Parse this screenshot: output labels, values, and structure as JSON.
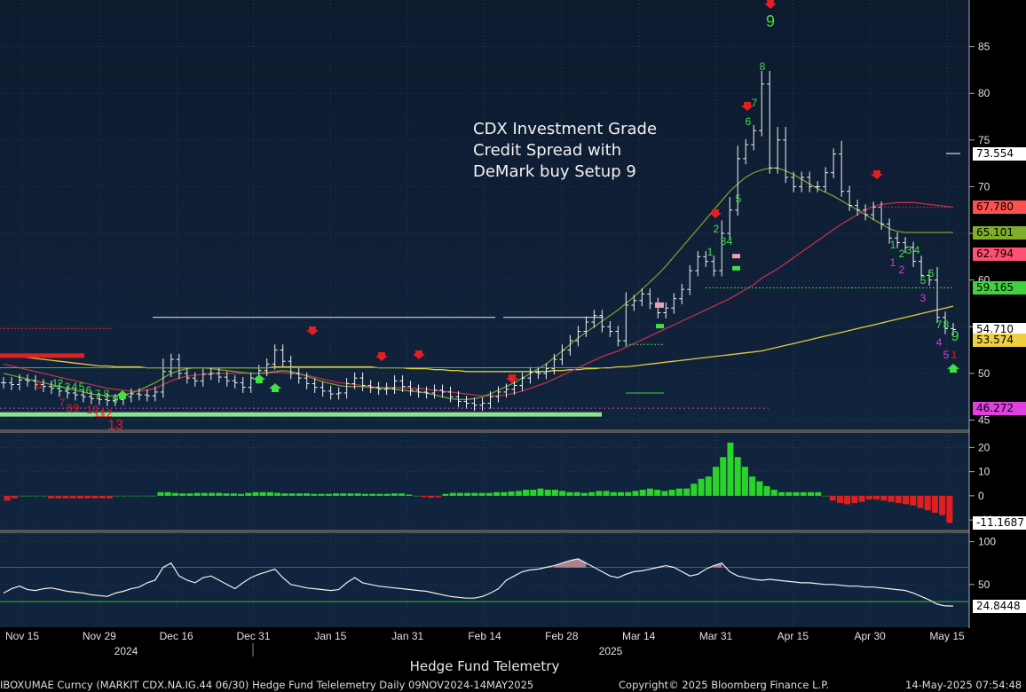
{
  "annotation": {
    "line1": "CDX Investment Grade",
    "line2": "Credit Spread with",
    "line3": "DeMark buy Setup 9"
  },
  "footer": {
    "title": "Hedge Fund Telemetry",
    "security": "IBOXUMAE Curncy (MARKIT CDX.NA.IG.44 06/30) Hedge Fund Telelemetry  Daily 09NOV2024-14MAY2025",
    "copyright": "Copyright© 2025 Bloomberg Finance L.P.",
    "timestamp": "14-May-2025 07:54:48"
  },
  "chart_data": [
    {
      "type": "line",
      "panel": "price",
      "ylim": [
        44,
        90
      ],
      "y_ticks": [
        45,
        50,
        55,
        60,
        65,
        70,
        75,
        80,
        85
      ],
      "x_tick_labels": [
        "Nov 15",
        "Nov 29",
        "Dec 16",
        "Dec 31",
        "Jan 15",
        "Jan 31",
        "Feb 14",
        "Feb 28",
        "Mar 14",
        "Mar 31",
        "Apr 15",
        "Apr 30",
        "May 15"
      ],
      "year_labels": [
        "2024",
        "2025"
      ],
      "price_closes": [
        49.0,
        48.8,
        49.3,
        49.2,
        48.8,
        48.6,
        48.4,
        48.1,
        47.9,
        47.7,
        47.5,
        47.3,
        47.2,
        47.1,
        47.2,
        47.5,
        47.8,
        47.7,
        47.6,
        48.0,
        50.2,
        51.5,
        50.0,
        49.5,
        49.2,
        49.9,
        50.0,
        49.6,
        49.2,
        49.0,
        48.5,
        49.5,
        50.3,
        51.0,
        52.5,
        51.3,
        50.0,
        49.5,
        48.9,
        48.5,
        48.1,
        47.8,
        47.9,
        48.9,
        49.5,
        48.7,
        48.5,
        48.3,
        48.4,
        49.2,
        48.6,
        48.2,
        48.0,
        47.9,
        48.2,
        48.0,
        47.5,
        47.0,
        46.8,
        46.6,
        46.8,
        47.5,
        48.0,
        48.3,
        48.7,
        49.5,
        50.1,
        50.0,
        50.5,
        51.5,
        52.5,
        53.5,
        54.5,
        55.5,
        56.2,
        55.0,
        54.5,
        53.5,
        57.3,
        57.8,
        58.5,
        57.5,
        56.5,
        57.0,
        58.0,
        59.0,
        61.0,
        62.5,
        62.0,
        61.0,
        65.0,
        67.5,
        73.0,
        74.5,
        76.0,
        81.0,
        72.0,
        75.0,
        71.0,
        70.0,
        71.0,
        70.0,
        70.0,
        71.5,
        73.5,
        69.5,
        68.0,
        67.5,
        67.0,
        67.8,
        66.0,
        64.5,
        64.0,
        63.5,
        62.0,
        60.5,
        60.0,
        56.0,
        54.8,
        54.7
      ],
      "series": [
        {
          "name": "",
          "color": "#e8c840",
          "values": [
            52.0,
            51.9,
            51.8,
            51.7,
            51.6,
            51.5,
            51.4,
            51.3,
            51.2,
            51.1,
            51.0,
            50.9,
            50.8,
            50.8,
            50.7,
            50.7,
            50.7,
            50.7,
            50.6,
            50.6,
            50.6,
            50.6,
            50.6,
            50.6,
            50.6,
            50.6,
            50.6,
            50.6,
            50.6,
            50.6,
            50.6,
            50.6,
            50.6,
            50.6,
            50.7,
            50.7,
            50.7,
            50.7,
            50.7,
            50.7,
            50.7,
            50.7,
            50.7,
            50.7,
            50.7,
            50.7,
            50.7,
            50.6,
            50.6,
            50.6,
            50.6,
            50.5,
            50.5,
            50.5,
            50.4,
            50.4,
            50.3,
            50.3,
            50.2,
            50.2,
            50.2,
            50.2,
            50.2,
            50.2,
            50.2,
            50.2,
            50.2,
            50.2,
            50.2,
            50.3,
            50.3,
            50.4,
            50.4,
            50.5,
            50.5,
            50.6,
            50.6,
            50.7,
            50.7,
            50.8,
            50.9,
            51.0,
            51.1,
            51.2,
            51.3,
            51.4,
            51.5,
            51.6,
            51.7,
            51.8,
            51.9,
            52.0,
            52.1,
            52.2,
            52.3,
            52.4,
            52.6,
            52.8,
            53.0,
            53.2,
            53.4,
            53.6,
            53.8,
            54.0,
            54.2,
            54.4,
            54.6,
            54.8,
            55.0,
            55.2,
            55.4,
            55.6,
            55.8,
            56.0,
            56.2,
            56.4,
            56.6,
            56.8,
            57.0,
            57.2
          ]
        },
        {
          "name": "",
          "color": "#c0304a",
          "values": [
            51.0,
            50.8,
            50.6,
            50.4,
            50.2,
            50.0,
            49.8,
            49.6,
            49.4,
            49.2,
            49.0,
            48.8,
            48.6,
            48.4,
            48.3,
            48.2,
            48.1,
            48.1,
            48.2,
            48.4,
            48.8,
            49.2,
            49.5,
            49.7,
            49.8,
            49.9,
            50.0,
            50.0,
            50.0,
            50.0,
            50.0,
            50.0,
            50.0,
            50.0,
            50.1,
            50.1,
            50.0,
            49.9,
            49.8,
            49.6,
            49.4,
            49.2,
            49.0,
            48.9,
            48.8,
            48.7,
            48.6,
            48.5,
            48.5,
            48.5,
            48.5,
            48.4,
            48.4,
            48.3,
            48.2,
            48.1,
            48.0,
            47.9,
            47.8,
            47.7,
            47.6,
            47.6,
            47.6,
            47.7,
            47.9,
            48.1,
            48.4,
            48.7,
            49.0,
            49.4,
            49.8,
            50.2,
            50.6,
            51.0,
            51.4,
            51.8,
            52.1,
            52.4,
            52.8,
            53.2,
            53.6,
            54.0,
            54.4,
            54.8,
            55.2,
            55.6,
            56.0,
            56.4,
            56.8,
            57.2,
            57.6,
            58.0,
            58.5,
            59.0,
            59.5,
            60.2,
            60.7,
            61.2,
            61.8,
            62.4,
            63.0,
            63.6,
            64.2,
            64.8,
            65.4,
            66.0,
            66.5,
            67.0,
            67.5,
            67.9,
            68.1,
            68.2,
            68.3,
            68.3,
            68.3,
            68.2,
            68.1,
            68.0,
            67.9,
            67.8
          ]
        },
        {
          "name": "",
          "color": "#7a9a30",
          "values": [
            50.0,
            49.8,
            49.6,
            49.4,
            49.2,
            49.0,
            48.8,
            48.6,
            48.4,
            48.2,
            48.0,
            47.8,
            47.7,
            47.6,
            47.6,
            47.7,
            47.9,
            48.2,
            48.6,
            49.0,
            49.5,
            50.0,
            50.3,
            50.5,
            50.6,
            50.6,
            50.5,
            50.4,
            50.3,
            50.2,
            50.1,
            50.0,
            50.0,
            50.1,
            50.2,
            50.3,
            50.2,
            50.0,
            49.7,
            49.4,
            49.1,
            48.9,
            48.7,
            48.6,
            48.6,
            48.6,
            48.5,
            48.4,
            48.4,
            48.3,
            48.2,
            48.1,
            48.0,
            47.9,
            47.7,
            47.5,
            47.3,
            47.2,
            47.2,
            47.3,
            47.5,
            47.8,
            48.2,
            48.6,
            49.0,
            49.5,
            50.0,
            50.5,
            51.0,
            51.7,
            52.4,
            53.1,
            53.8,
            54.4,
            55.0,
            55.6,
            56.2,
            56.8,
            57.5,
            58.2,
            59.0,
            59.8,
            60.6,
            61.5,
            62.5,
            63.5,
            64.5,
            65.5,
            66.5,
            67.5,
            68.5,
            69.5,
            70.3,
            71.0,
            71.5,
            71.8,
            72.0,
            72.0,
            71.7,
            71.3,
            70.8,
            70.3,
            69.8,
            69.4,
            69.0,
            68.5,
            68.0,
            67.5,
            67.0,
            66.5,
            66.0,
            65.5,
            65.2,
            65.1,
            65.1,
            65.1,
            65.1,
            65.1,
            65.1,
            65.1
          ]
        }
      ],
      "last_value_tags": [
        {
          "label": "73.554",
          "bg": "#ffffff",
          "fg": "#000000",
          "value": 73.554
        },
        {
          "label": "67.780",
          "bg": "#ff5050",
          "fg": "#000000",
          "value": 67.78
        },
        {
          "label": "65.101",
          "bg": "#7fae2a",
          "fg": "#000000",
          "value": 65.101
        },
        {
          "label": "62.794",
          "bg": "#ff5070",
          "fg": "#000000",
          "value": 62.794
        },
        {
          "label": "59.165",
          "bg": "#40d040",
          "fg": "#000000",
          "value": 59.165
        },
        {
          "label": "54.710",
          "bg": "#ffffff",
          "fg": "#000000",
          "value": 54.71
        },
        {
          "label": "53.574",
          "bg": "#f0d040",
          "fg": "#000000",
          "value": 53.574
        },
        {
          "label": "46.272",
          "bg": "#e040e0",
          "fg": "#000000",
          "value": 46.272
        }
      ],
      "setup_labels_green": [
        "1",
        "2",
        "3",
        "4",
        "5",
        "6",
        "7",
        "8",
        "9"
      ],
      "setup_labels_red": [
        "6",
        "7",
        "8",
        "9",
        "10",
        "11",
        "12",
        "13"
      ]
    },
    {
      "type": "bar",
      "panel": "histogram",
      "ylim": [
        -14,
        26
      ],
      "y_ticks": [
        -10,
        0,
        10,
        20
      ],
      "last_value_label": "-11.1687",
      "values": [
        -2,
        -1,
        0,
        0,
        0,
        0,
        -1,
        -1,
        -1,
        -1,
        -1,
        -1,
        -1,
        -1,
        -1,
        0,
        0,
        0,
        0,
        0,
        0,
        1.5,
        1.5,
        1.2,
        1,
        1,
        1.2,
        1.2,
        1.2,
        1.2,
        1,
        1,
        0.8,
        1.2,
        1.5,
        1.5,
        1.5,
        1.2,
        1,
        1,
        1,
        1,
        0.8,
        0.8,
        0.8,
        1,
        1,
        1,
        1,
        0.8,
        0.8,
        0.8,
        0.8,
        1,
        1,
        0.5,
        0,
        -0.5,
        -0.8,
        -0.6,
        0.8,
        1.2,
        1.2,
        1.2,
        1.2,
        1.2,
        1.2,
        1.5,
        1.5,
        1.8,
        2,
        2.5,
        2.5,
        3,
        2.5,
        2.5,
        2,
        1.5,
        1.5,
        1.2,
        1.5,
        2,
        2,
        1.5,
        1.5,
        1.5,
        2,
        2.5,
        3,
        2.5,
        2,
        2.5,
        3,
        3,
        5,
        7,
        8,
        12,
        16,
        22,
        16,
        12,
        8,
        6,
        4,
        2.5,
        1.5,
        1.5,
        1.5,
        1.5,
        1.5,
        1.5,
        0,
        -2,
        -3,
        -3.5,
        -3,
        -2.5,
        -1.5,
        -1.5,
        -2,
        -2.5,
        -3,
        -3.5,
        -4,
        -5,
        -6,
        -7,
        -8,
        -11.2
      ]
    },
    {
      "type": "line",
      "panel": "oscillator",
      "ylim": [
        0,
        110
      ],
      "y_ticks": [
        50,
        100
      ],
      "upper_band": 70,
      "lower_band": 30,
      "last_value_label": "24.8448",
      "values": [
        40,
        45,
        48,
        44,
        43,
        45,
        46,
        44,
        42,
        41,
        40,
        38,
        37,
        36,
        40,
        42,
        45,
        47,
        52,
        55,
        70,
        75,
        60,
        55,
        52,
        58,
        60,
        55,
        50,
        45,
        52,
        58,
        62,
        65,
        68,
        58,
        50,
        48,
        46,
        45,
        44,
        43,
        44,
        52,
        58,
        52,
        50,
        48,
        47,
        46,
        45,
        44,
        43,
        42,
        40,
        38,
        36,
        35,
        34,
        34,
        36,
        40,
        45,
        55,
        60,
        65,
        67,
        68,
        70,
        72,
        75,
        78,
        80,
        75,
        70,
        65,
        60,
        58,
        62,
        65,
        66,
        68,
        70,
        72,
        70,
        65,
        60,
        62,
        68,
        72,
        75,
        65,
        60,
        58,
        56,
        55,
        56,
        55,
        54,
        53,
        52,
        52,
        51,
        50,
        50,
        49,
        48,
        48,
        47,
        47,
        46,
        45,
        44,
        43,
        40,
        36,
        32,
        27,
        25,
        24.8
      ]
    }
  ]
}
